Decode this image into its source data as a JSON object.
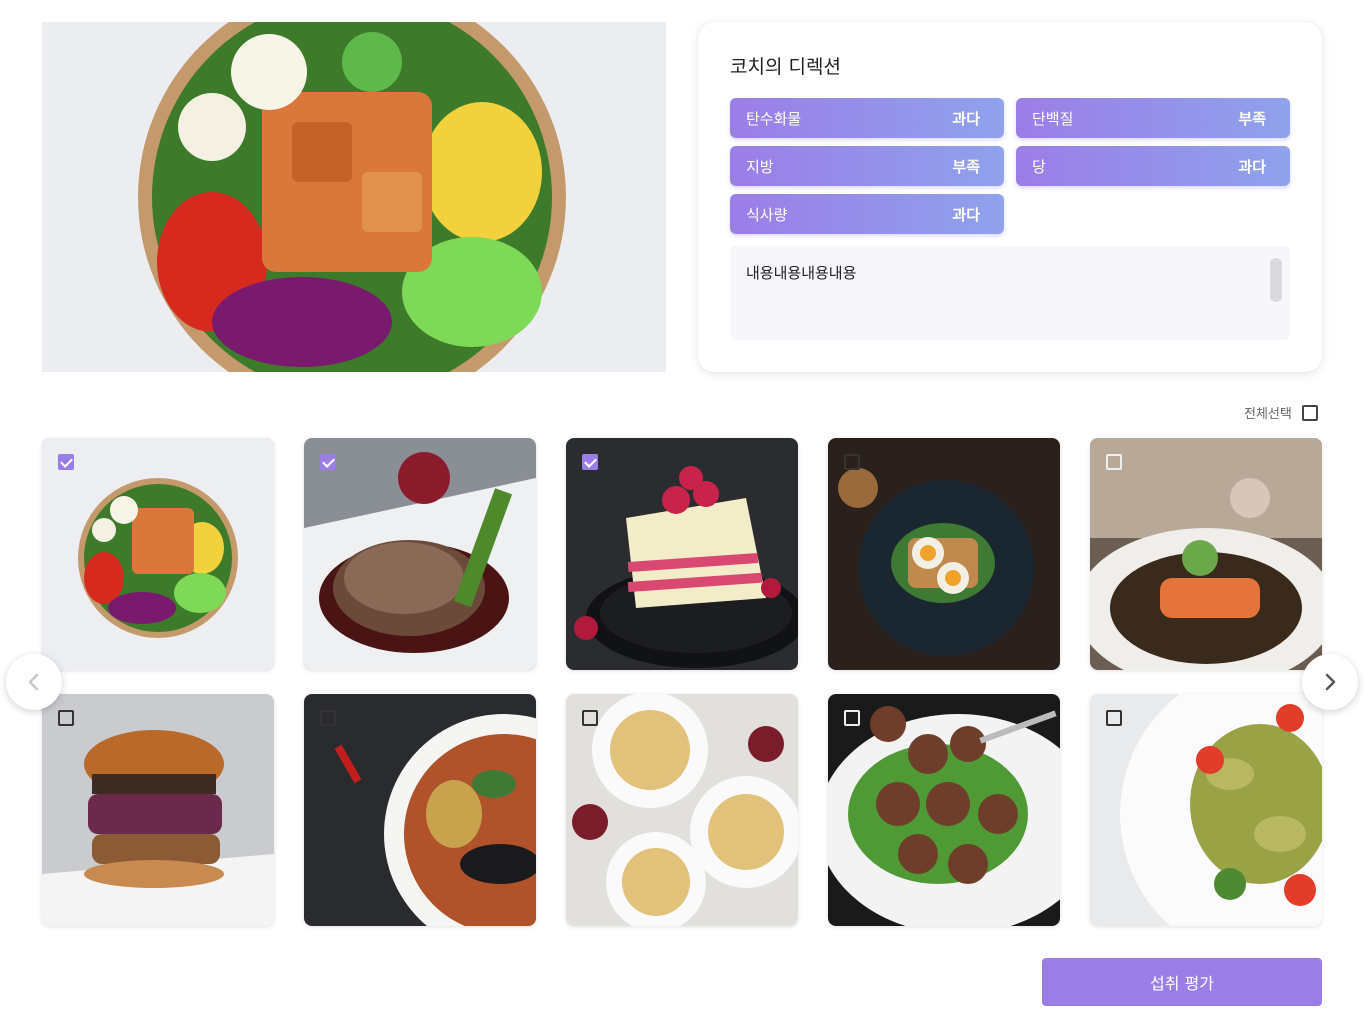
{
  "coach": {
    "title": "코치의 디렉션",
    "nutrients": [
      {
        "name": "탄수화물",
        "status": "과다"
      },
      {
        "name": "단백질",
        "status": "부족"
      },
      {
        "name": "지방",
        "status": "부족"
      },
      {
        "name": "당",
        "status": "과다"
      },
      {
        "name": "식사량",
        "status": "과다"
      }
    ],
    "memo": "내용내용내용내용"
  },
  "gallery": {
    "select_all_label": "전체선택",
    "select_all_checked": false,
    "items": [
      {
        "icon": "salad-bowl-photo",
        "checked": true
      },
      {
        "icon": "steak-photo",
        "checked": true
      },
      {
        "icon": "cake-photo",
        "checked": true
      },
      {
        "icon": "egg-toast-photo",
        "checked": false
      },
      {
        "icon": "salmon-photo",
        "checked": false
      },
      {
        "icon": "burger-photo",
        "checked": false
      },
      {
        "icon": "curry-photo",
        "checked": false
      },
      {
        "icon": "pasta-photo",
        "checked": false
      },
      {
        "icon": "meatball-photo",
        "checked": false
      },
      {
        "icon": "farfalle-salad-photo",
        "checked": false
      }
    ]
  },
  "actions": {
    "evaluate_label": "섭취 평가"
  },
  "colors": {
    "accent": "#9b7de8",
    "chip_gradient_end": "#8fa2ec"
  }
}
